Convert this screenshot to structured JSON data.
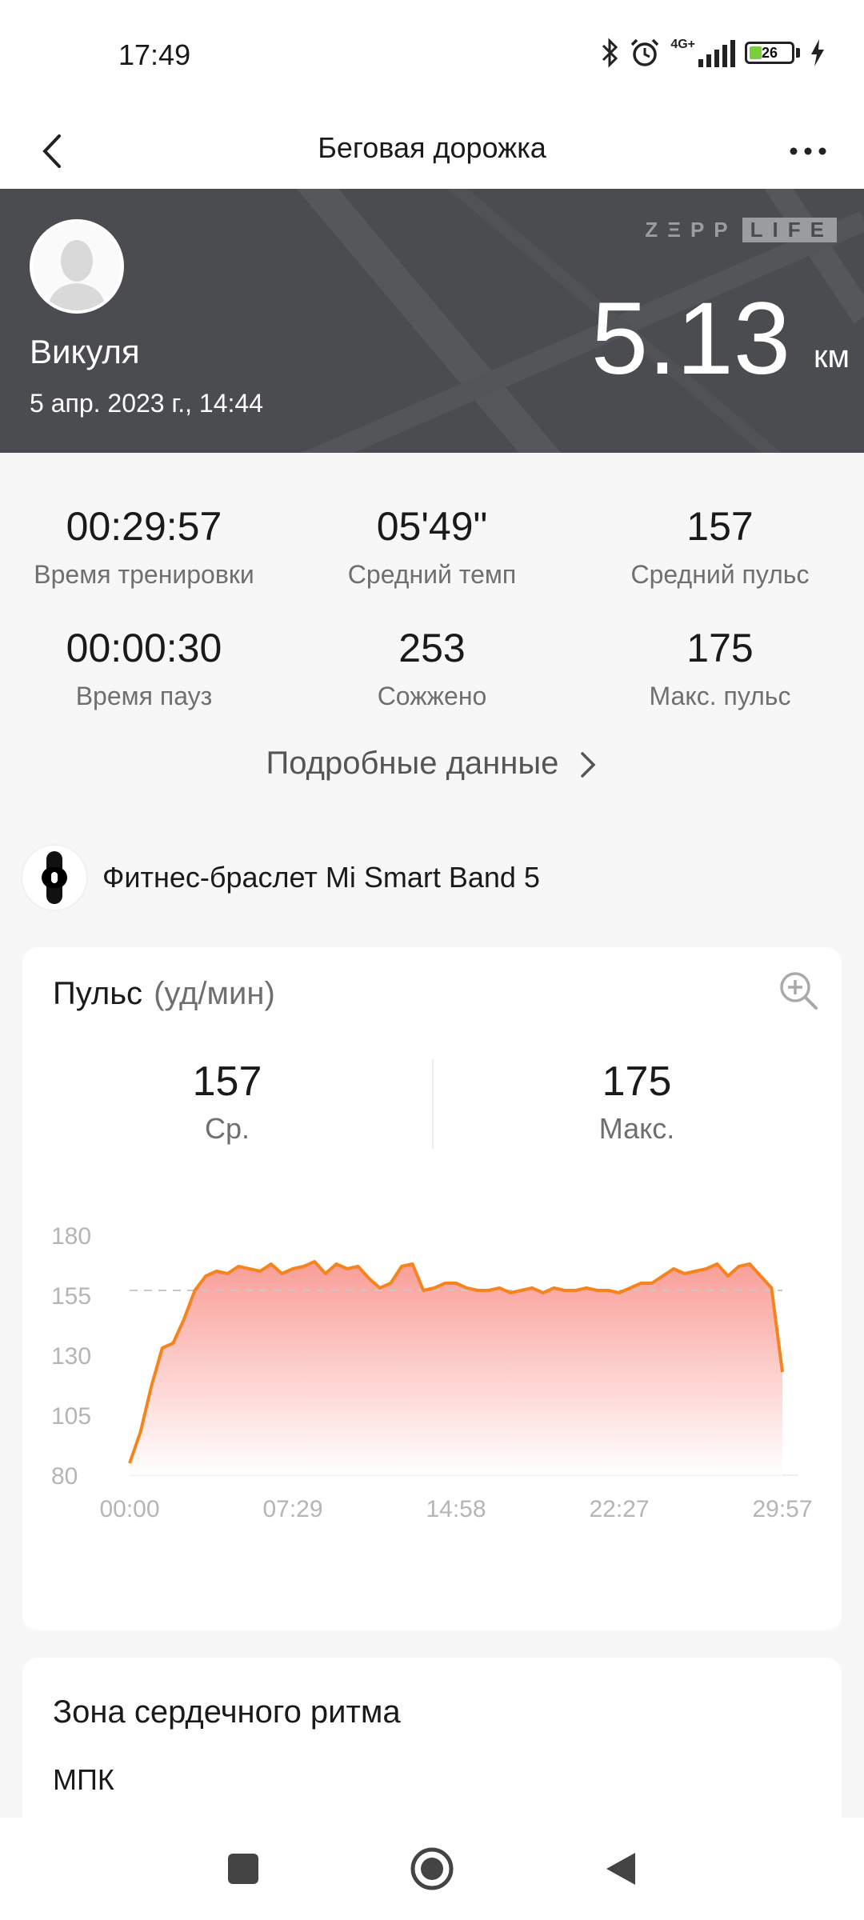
{
  "status_bar": {
    "time": "17:49",
    "network": "4G+",
    "battery": "26",
    "icons": [
      "bluetooth-icon",
      "alarm-icon",
      "signal-icon",
      "battery-icon",
      "charging-icon"
    ]
  },
  "header": {
    "title": "Беговая дорожка",
    "icons": [
      "back-arrow-icon",
      "more-dots-icon"
    ]
  },
  "hero": {
    "name": "Викуля",
    "date": "5 апр. 2023 г., 14:44",
    "brand_left": "ZΞPP",
    "brand_right": "LIFE",
    "distance": "5.13",
    "distance_unit": "км"
  },
  "stats": [
    {
      "value": "00:29:57",
      "label": "Время тренировки"
    },
    {
      "value": "05'49\"",
      "label": "Средний темп"
    },
    {
      "value": "157",
      "label": "Средний пульс"
    },
    {
      "value": "00:00:30",
      "label": "Время пауз"
    },
    {
      "value": "253",
      "label": "Сожжено"
    },
    {
      "value": "175",
      "label": "Макс. пульс"
    }
  ],
  "details_link": "Подробные данные",
  "device": {
    "name": "Фитнес-браслет Mi Smart Band 5"
  },
  "pulse_card": {
    "title": "Пульс",
    "unit": "(уд/мин)",
    "avg_value": "157",
    "avg_label": "Ср.",
    "max_value": "175",
    "max_label": "Макс."
  },
  "chart_data": {
    "type": "area",
    "title": "",
    "xlabel": "",
    "ylabel": "",
    "ylim": [
      80,
      180
    ],
    "yticks": [
      "180",
      "155",
      "130",
      "105",
      "80"
    ],
    "xticks": [
      "00:00",
      "07:29",
      "14:58",
      "22:27",
      "29:57"
    ],
    "average_line": 157,
    "colors": {
      "line": "#f5841f",
      "fill_top": "#fa9d97",
      "fill_bottom": "#ffffff",
      "avg_line": "#c9c9c9"
    },
    "series": [
      {
        "x": [
          "00:00",
          "00:30",
          "01:00",
          "01:30",
          "02:00",
          "02:30",
          "03:00",
          "03:30",
          "04:00",
          "04:30",
          "05:00",
          "05:30",
          "06:00",
          "06:30",
          "07:00",
          "07:29",
          "08:00",
          "08:30",
          "09:00",
          "09:30",
          "10:00",
          "10:30",
          "11:00",
          "11:30",
          "12:00",
          "12:30",
          "13:00",
          "13:30",
          "14:00",
          "14:30",
          "14:58",
          "15:30",
          "16:00",
          "16:30",
          "17:00",
          "17:30",
          "18:00",
          "18:30",
          "19:00",
          "19:30",
          "20:00",
          "20:30",
          "21:00",
          "21:30",
          "22:00",
          "22:27",
          "23:00",
          "23:30",
          "24:00",
          "24:30",
          "25:00",
          "25:30",
          "26:00",
          "26:30",
          "27:00",
          "27:30",
          "28:00",
          "28:30",
          "29:00",
          "29:30",
          "29:57"
        ],
        "values": [
          85,
          98,
          117,
          133,
          135,
          145,
          157,
          163,
          165,
          164,
          167,
          166,
          165,
          168,
          164,
          166,
          167,
          169,
          164,
          168,
          166,
          167,
          162,
          158,
          160,
          167,
          168,
          157,
          158,
          160,
          160,
          158,
          157,
          157,
          158,
          156,
          157,
          158,
          156,
          158,
          157,
          157,
          158,
          157,
          157,
          156,
          158,
          160,
          160,
          163,
          166,
          164,
          165,
          166,
          168,
          163,
          167,
          168,
          163,
          158,
          123
        ]
      }
    ]
  },
  "zone_card": {
    "title": "Зона сердечного ритма",
    "subtitle": "МПК"
  },
  "navbar": {
    "icons": [
      "recents-square-icon",
      "home-circle-icon",
      "back-triangle-icon"
    ]
  }
}
